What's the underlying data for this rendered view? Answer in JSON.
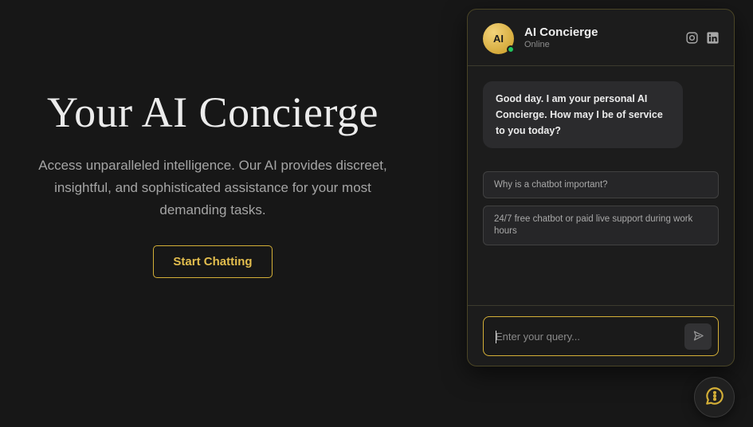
{
  "hero": {
    "title": "Your AI Concierge",
    "subtitle": "Access unparalleled intelligence. Our AI provides discreet, insightful, and sophisticated assistance for your most demanding tasks.",
    "cta_label": "Start Chatting"
  },
  "chat": {
    "avatar_initials": "AI",
    "name": "AI Concierge",
    "status": "Online",
    "social_icons": [
      "instagram-icon",
      "linkedin-icon"
    ],
    "welcome_message": "Good day. I am your personal AI Concierge. How may I be of service to you today?",
    "suggestions": [
      "Why is a chatbot important?",
      "24/7 free chatbot or paid live support during work hours"
    ],
    "input_placeholder": "Enter your query...",
    "input_value": "",
    "send_icon": "send-icon"
  },
  "launcher": {
    "icon": "chat-bubble-icon"
  },
  "colors": {
    "background": "#171717",
    "accent_gold": "#d4af37",
    "online_green": "#22c55e",
    "panel": "#1c1c1c"
  }
}
